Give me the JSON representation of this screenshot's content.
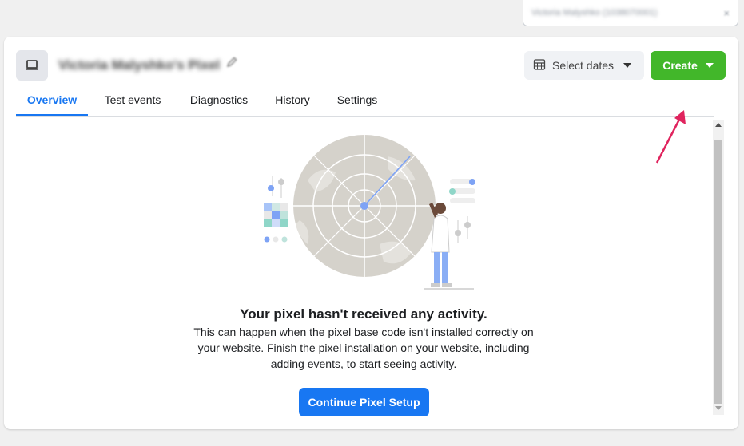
{
  "account_selector": {
    "text": "Victoria Malyshko (1038070001)",
    "close": "×"
  },
  "header": {
    "pixel_name": "Victoria Malyshko's Pixel",
    "dates_button": "Select dates",
    "create_button": "Create"
  },
  "tabs": [
    {
      "label": "Overview",
      "active": true
    },
    {
      "label": "Test events",
      "active": false
    },
    {
      "label": "Diagnostics",
      "active": false
    },
    {
      "label": "History",
      "active": false
    },
    {
      "label": "Settings",
      "active": false
    }
  ],
  "empty_state": {
    "title": "Your pixel hasn't received any activity.",
    "body": "This can happen when the pixel base code isn't installed correctly on your website. Finish the pixel installation on your website, including adding events, to start seeing activity.",
    "button": "Continue Pixel Setup"
  },
  "colors": {
    "accent": "#1877f2",
    "create": "#42b72a",
    "annotation_arrow": "#e0245e"
  },
  "icons": [
    "laptop-icon",
    "pencil-icon",
    "calendar-icon",
    "chevron-down-icon",
    "radar-illustration"
  ]
}
